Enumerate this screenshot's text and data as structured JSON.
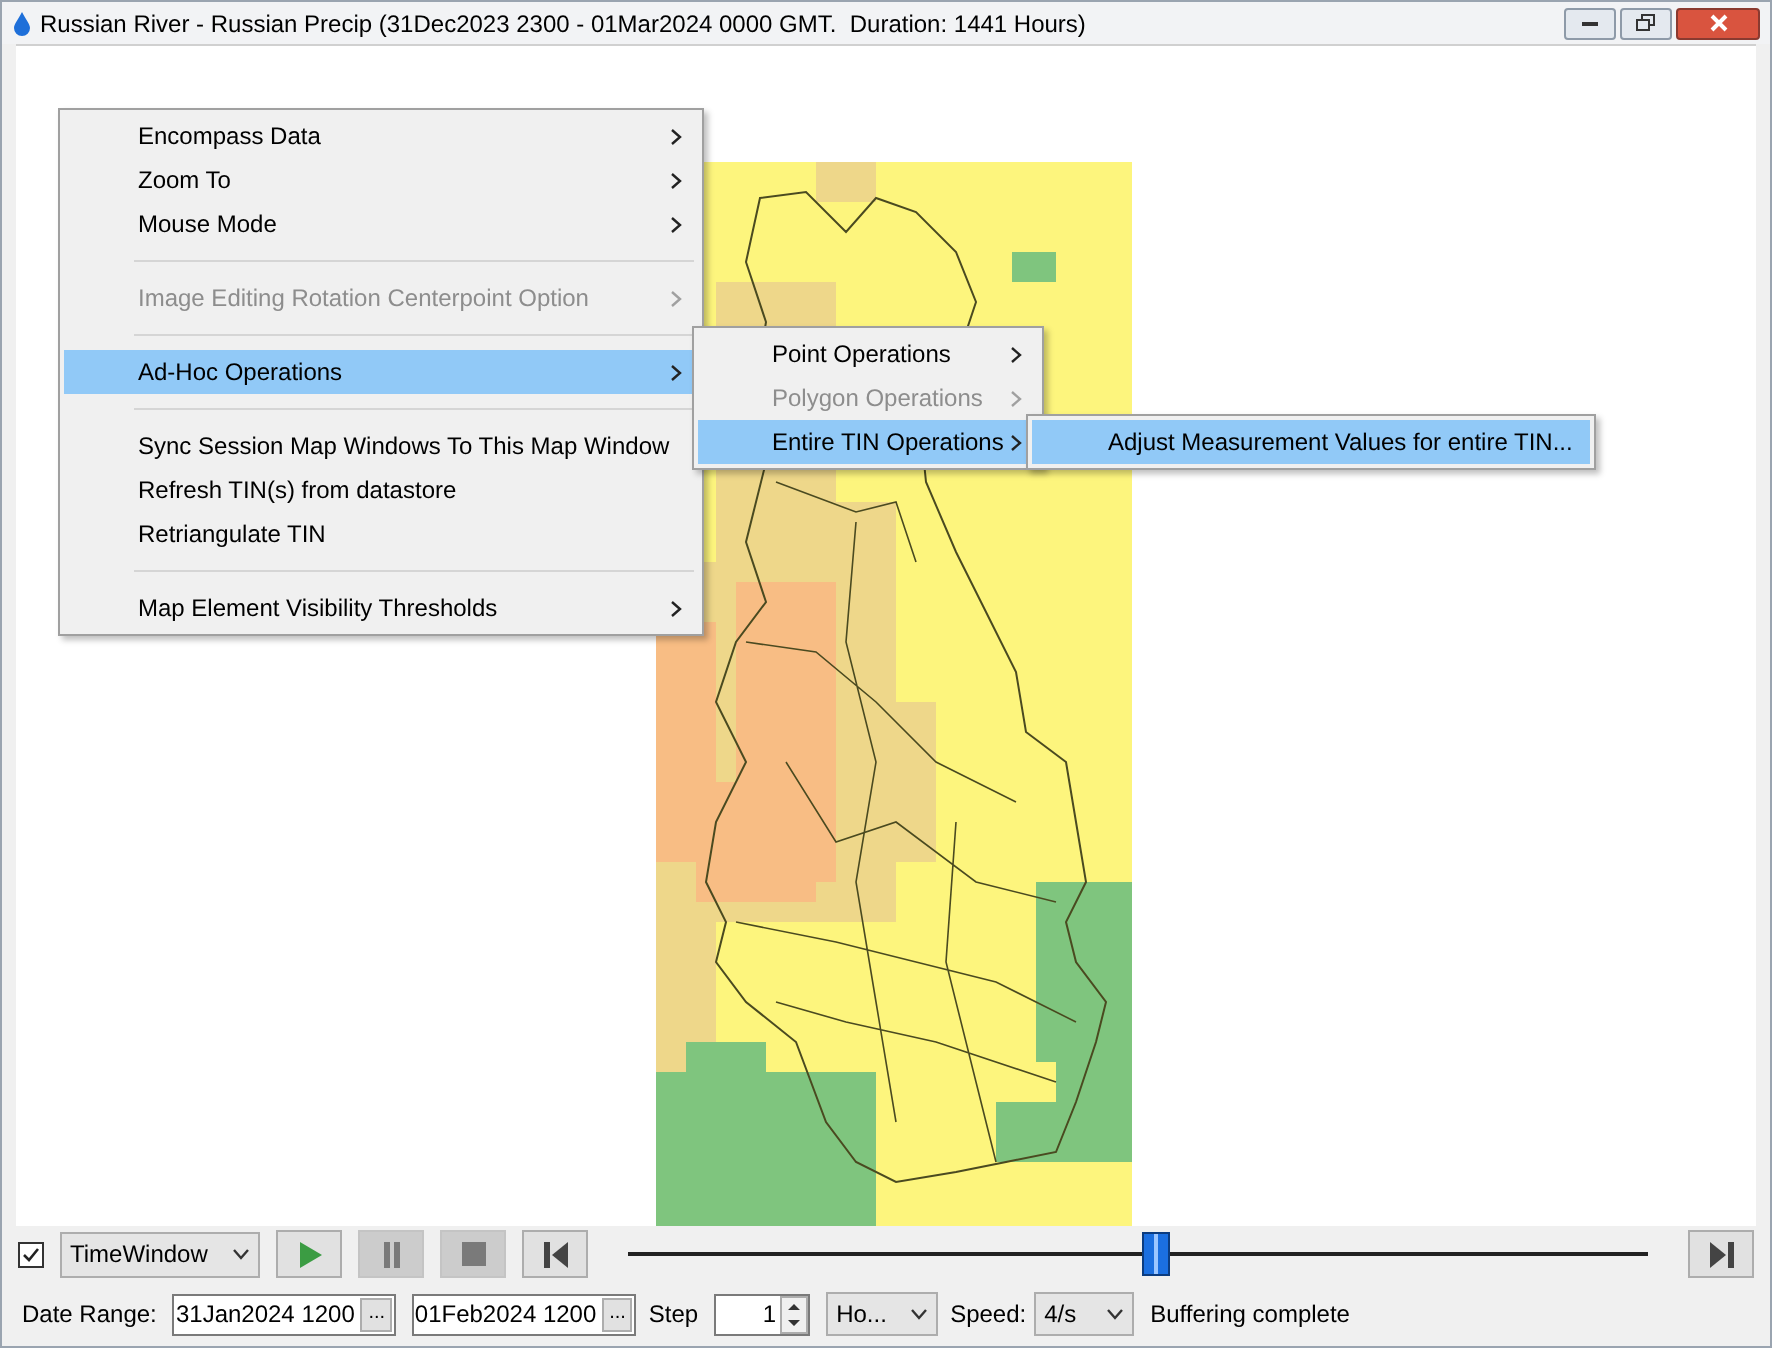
{
  "window": {
    "title": "Russian River - Russian Precip (31Dec2023 2300 - 01Mar2024 0000 GMT.  Duration: 1441 Hours)"
  },
  "context_menu": {
    "items": [
      {
        "kind": "item",
        "label": "Encompass Data",
        "disabled": false,
        "selected": false,
        "submenu": true
      },
      {
        "kind": "item",
        "label": "Zoom To",
        "disabled": false,
        "selected": false,
        "submenu": true
      },
      {
        "kind": "item",
        "label": "Mouse Mode",
        "disabled": false,
        "selected": false,
        "submenu": true
      },
      {
        "kind": "separator"
      },
      {
        "kind": "item",
        "label": "Image Editing Rotation Centerpoint Option",
        "disabled": true,
        "selected": false,
        "submenu": true
      },
      {
        "kind": "separator"
      },
      {
        "kind": "item",
        "label": "Ad-Hoc Operations",
        "disabled": false,
        "selected": true,
        "submenu": true,
        "children": [
          {
            "kind": "item",
            "label": "Point Operations",
            "disabled": false,
            "selected": false,
            "submenu": true
          },
          {
            "kind": "item",
            "label": "Polygon Operations",
            "disabled": true,
            "selected": false,
            "submenu": true
          },
          {
            "kind": "item",
            "label": "Entire TIN Operations",
            "disabled": false,
            "selected": true,
            "submenu": true,
            "children": [
              {
                "kind": "item",
                "label": "Adjust Measurement Values for entire TIN...",
                "disabled": false,
                "selected": true,
                "submenu": false
              }
            ]
          }
        ]
      },
      {
        "kind": "separator"
      },
      {
        "kind": "item",
        "label": "Sync Session Map Windows To This Map Window",
        "disabled": false,
        "selected": false,
        "submenu": false
      },
      {
        "kind": "item",
        "label": "Refresh TIN(s) from datastore",
        "disabled": false,
        "selected": false,
        "submenu": false
      },
      {
        "kind": "item",
        "label": "Retriangulate TIN",
        "disabled": false,
        "selected": false,
        "submenu": false
      },
      {
        "kind": "separator"
      },
      {
        "kind": "item",
        "label": "Map Element Visibility Thresholds",
        "disabled": false,
        "selected": false,
        "submenu": true
      }
    ]
  },
  "playback": {
    "enabled_checked": true,
    "mode": "TimeWindow",
    "play_disabled": false,
    "pause_disabled": true,
    "stop_disabled": true,
    "level": 0.517
  },
  "date_range": {
    "label": "Date Range:",
    "start": "31Jan2024 1200",
    "start_button": "...",
    "end": "01Feb2024 1200",
    "end_button": "...",
    "step_label": "Step",
    "step": "1",
    "unit": "Ho...",
    "speed_label": "Speed:",
    "speed": "4/s",
    "status": "Buffering complete"
  }
}
